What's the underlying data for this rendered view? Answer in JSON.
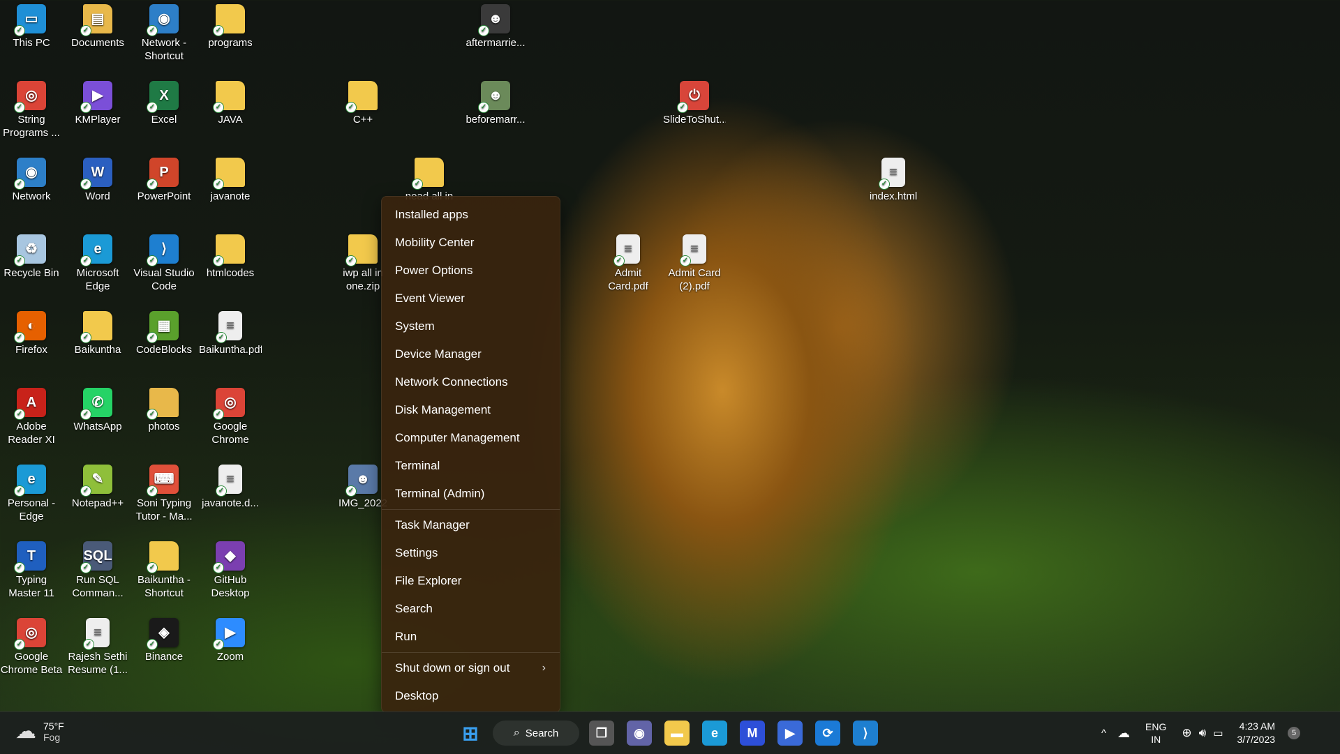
{
  "desktop": {
    "icons": [
      {
        "label": "This PC",
        "color": "#1f8fd6",
        "glyph": "▭"
      },
      {
        "label": "Documents",
        "color": "#e8b84a",
        "glyph": "▤"
      },
      {
        "label": "Network - Shortcut",
        "color": "#2d7fc8",
        "glyph": "◉"
      },
      {
        "label": "programs",
        "color": "#f2c94c",
        "glyph": ""
      },
      {
        "label": "aftermarrie...",
        "color": "#3a3a3a",
        "glyph": "☻"
      },
      {
        "label": "String Programs ...",
        "color": "#db4437",
        "glyph": "◎"
      },
      {
        "label": "KMPlayer",
        "color": "#7b4fd8",
        "glyph": "▶"
      },
      {
        "label": "Excel",
        "color": "#1f7a45",
        "glyph": "X"
      },
      {
        "label": "JAVA",
        "color": "#f2c94c",
        "glyph": ""
      },
      {
        "label": "C++",
        "color": "#f2c94c",
        "glyph": ""
      },
      {
        "label": "beforemarr...",
        "color": "#6b8a5a",
        "glyph": "☻"
      },
      {
        "label": "SlideToShut...",
        "color": "#d8453a",
        "glyph": "⏻"
      },
      {
        "label": "Network",
        "color": "#2d7fc8",
        "glyph": "◉"
      },
      {
        "label": "Word",
        "color": "#2b5fc0",
        "glyph": "W"
      },
      {
        "label": "PowerPoint",
        "color": "#d0452a",
        "glyph": "P"
      },
      {
        "label": "javanote",
        "color": "#f2c94c",
        "glyph": ""
      },
      {
        "label": "nead all in",
        "color": "#f2c94c",
        "glyph": ""
      },
      {
        "label": "index.html",
        "color": "#eeeeee",
        "glyph": "≡"
      },
      {
        "label": "Recycle Bin",
        "color": "#a8c6e0",
        "glyph": "♻"
      },
      {
        "label": "Microsoft Edge",
        "color": "#1b9ad6",
        "glyph": "e"
      },
      {
        "label": "Visual Studio Code",
        "color": "#1e7fd0",
        "glyph": "⟩"
      },
      {
        "label": "htmlcodes",
        "color": "#f2c94c",
        "glyph": ""
      },
      {
        "label": "iwp all in one.zip",
        "color": "#f2c94c",
        "glyph": ""
      },
      {
        "label": "Admit Card.pdf",
        "color": "#eeeeee",
        "glyph": "≡"
      },
      {
        "label": "Admit Card (2).pdf",
        "color": "#eeeeee",
        "glyph": "≡"
      },
      {
        "label": "Firefox",
        "color": "#e66000",
        "glyph": "◐"
      },
      {
        "label": "Baikuntha",
        "color": "#f2c94c",
        "glyph": ""
      },
      {
        "label": "CodeBlocks",
        "color": "#5aa02c",
        "glyph": "▦"
      },
      {
        "label": "Baikuntha.pdf",
        "color": "#eeeeee",
        "glyph": "≡"
      },
      {
        "label": "Adobe Reader XI",
        "color": "#c8221a",
        "glyph": "A"
      },
      {
        "label": "WhatsApp",
        "color": "#25d366",
        "glyph": "✆"
      },
      {
        "label": "photos",
        "color": "#e8b84a",
        "glyph": ""
      },
      {
        "label": "Google Chrome",
        "color": "#db4437",
        "glyph": "◎"
      },
      {
        "label": "Personal - Edge",
        "color": "#1b9ad6",
        "glyph": "e"
      },
      {
        "label": "Notepad++",
        "color": "#8fbf3a",
        "glyph": "✎"
      },
      {
        "label": "Soni Typing Tutor - Ma...",
        "color": "#e0503a",
        "glyph": "⌨"
      },
      {
        "label": "javanote.d...",
        "color": "#eeeeee",
        "glyph": "≡"
      },
      {
        "label": "IMG_2022",
        "color": "#5a7aa8",
        "glyph": "☻"
      },
      {
        "label": "Typing Master 11",
        "color": "#1f5fbf",
        "glyph": "T"
      },
      {
        "label": "Run SQL Comman...",
        "color": "#4a5a78",
        "glyph": "SQL"
      },
      {
        "label": "Baikuntha - Shortcut",
        "color": "#f2c94c",
        "glyph": ""
      },
      {
        "label": "GitHub Desktop",
        "color": "#7b3fb0",
        "glyph": "◆"
      },
      {
        "label": "Google Chrome Beta",
        "color": "#db4437",
        "glyph": "◎"
      },
      {
        "label": "Rajesh Sethi Resume (1...",
        "color": "#eeeeee",
        "glyph": "≡"
      },
      {
        "label": "Binance",
        "color": "#1a1a1a",
        "glyph": "◈"
      },
      {
        "label": "Zoom",
        "color": "#2d8cff",
        "glyph": "▶"
      }
    ]
  },
  "context_menu": {
    "items": [
      "Installed apps",
      "Mobility Center",
      "Power Options",
      "Event Viewer",
      "System",
      "Device Manager",
      "Network Connections",
      "Disk Management",
      "Computer Management",
      "Terminal",
      "Terminal (Admin)",
      "Task Manager",
      "Settings",
      "File Explorer",
      "Search",
      "Run",
      "Shut down or sign out",
      "Desktop"
    ],
    "submenu_chevron": "›"
  },
  "taskbar": {
    "weather": {
      "temp": "75°F",
      "condition": "Fog"
    },
    "search_label": "Search",
    "apps": [
      {
        "name": "start-icon",
        "color": "#3aa0f0",
        "glyph": "⊞"
      },
      {
        "name": "task-view-icon",
        "color": "#555",
        "glyph": "❐"
      },
      {
        "name": "teams-chat-icon",
        "color": "#6264a7",
        "glyph": "◉"
      },
      {
        "name": "file-explorer-icon",
        "color": "#f2c94c",
        "glyph": "▬"
      },
      {
        "name": "edge-icon",
        "color": "#1b9ad6",
        "glyph": "e"
      },
      {
        "name": "app-icon",
        "color": "#2d4fd8",
        "glyph": "M"
      },
      {
        "name": "copilot-icon",
        "color": "#3a6ad8",
        "glyph": "▶"
      },
      {
        "name": "remote-app-icon",
        "color": "#1b7ad6",
        "glyph": "⟳"
      },
      {
        "name": "vscode-icon",
        "color": "#1e7fd0",
        "glyph": "⟩"
      }
    ],
    "tray": {
      "chevron": "^",
      "lang_line1": "ENG",
      "lang_line2": "IN",
      "time": "4:23 AM",
      "date": "3/7/2023",
      "notification_count": "5"
    }
  }
}
